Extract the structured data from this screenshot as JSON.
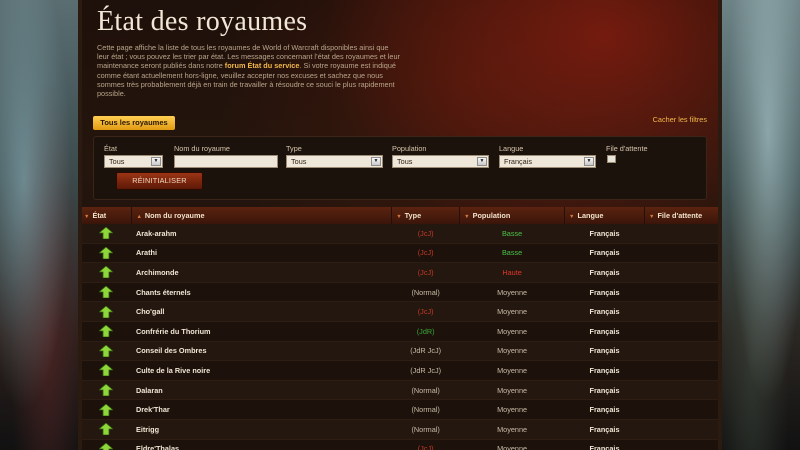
{
  "header": {
    "title": "État des royaumes",
    "intro_before": "Cette page affiche la liste de tous les royaumes de World of Warcraft disponibles ainsi que leur état ; vous pouvez les trier par état. Les messages concernant l’état des royaumes et leur maintenance seront publiés dans notre ",
    "intro_link": "forum État du service",
    "intro_after": ". Si votre royaume est indiqué comme étant actuellement hors-ligne, veuillez accepter nos excuses et sachez que nous sommes très probablement déjà en train de travailler à résoudre ce souci le plus rapidement possible."
  },
  "tabs": {
    "all_realms": "Tous les royaumes"
  },
  "hide_filters": "Cacher les filtres",
  "filters": {
    "status": {
      "label": "État",
      "value": "Tous"
    },
    "realm_name": {
      "label": "Nom du royaume",
      "value": ""
    },
    "type": {
      "label": "Type",
      "value": "Tous"
    },
    "population": {
      "label": "Population",
      "value": "Tous"
    },
    "language": {
      "label": "Langue",
      "value": "Français"
    },
    "queue": {
      "label": "File d'attente",
      "checked": false
    },
    "reset_label": "RÉINITIALISER"
  },
  "table": {
    "columns": [
      "État",
      "Nom du royaume",
      "Type",
      "Population",
      "Langue",
      "File d'attente"
    ],
    "rows": [
      {
        "status": "up",
        "name": "Arak-arahm",
        "type": "(JcJ)",
        "population": "Basse",
        "language": "Français",
        "queue": ""
      },
      {
        "status": "up",
        "name": "Arathi",
        "type": "(JcJ)",
        "population": "Basse",
        "language": "Français",
        "queue": ""
      },
      {
        "status": "up",
        "name": "Archimonde",
        "type": "(JcJ)",
        "population": "Haute",
        "language": "Français",
        "queue": ""
      },
      {
        "status": "up",
        "name": "Chants éternels",
        "type": "(Normal)",
        "population": "Moyenne",
        "language": "Français",
        "queue": ""
      },
      {
        "status": "up",
        "name": "Cho'gall",
        "type": "(JcJ)",
        "population": "Moyenne",
        "language": "Français",
        "queue": ""
      },
      {
        "status": "up",
        "name": "Confrérie du Thorium",
        "type": "(JdR)",
        "population": "Moyenne",
        "language": "Français",
        "queue": ""
      },
      {
        "status": "up",
        "name": "Conseil des Ombres",
        "type": "(JdR JcJ)",
        "population": "Moyenne",
        "language": "Français",
        "queue": ""
      },
      {
        "status": "up",
        "name": "Culte de la Rive noire",
        "type": "(JdR JcJ)",
        "population": "Moyenne",
        "language": "Français",
        "queue": ""
      },
      {
        "status": "up",
        "name": "Dalaran",
        "type": "(Normal)",
        "population": "Moyenne",
        "language": "Français",
        "queue": ""
      },
      {
        "status": "up",
        "name": "Drek'Thar",
        "type": "(Normal)",
        "population": "Moyenne",
        "language": "Français",
        "queue": ""
      },
      {
        "status": "up",
        "name": "Eitrigg",
        "type": "(Normal)",
        "population": "Moyenne",
        "language": "Français",
        "queue": ""
      },
      {
        "status": "up",
        "name": "Eldre'Thalas",
        "type": "(JcJ)",
        "population": "Moyenne",
        "language": "Français",
        "queue": ""
      }
    ]
  },
  "colors": {
    "type_JcJ": "#c73a26",
    "type_Normal": "#c9bba7",
    "type_JdR": "#3aa635",
    "type_JdR JcJ": "#c9bba7",
    "pop_Basse": "#4cc04a",
    "pop_Haute": "#e0372b",
    "pop_Moyenne": "#c9bba7",
    "accent": "#f2b84b",
    "status_up": "#8fd63a"
  }
}
